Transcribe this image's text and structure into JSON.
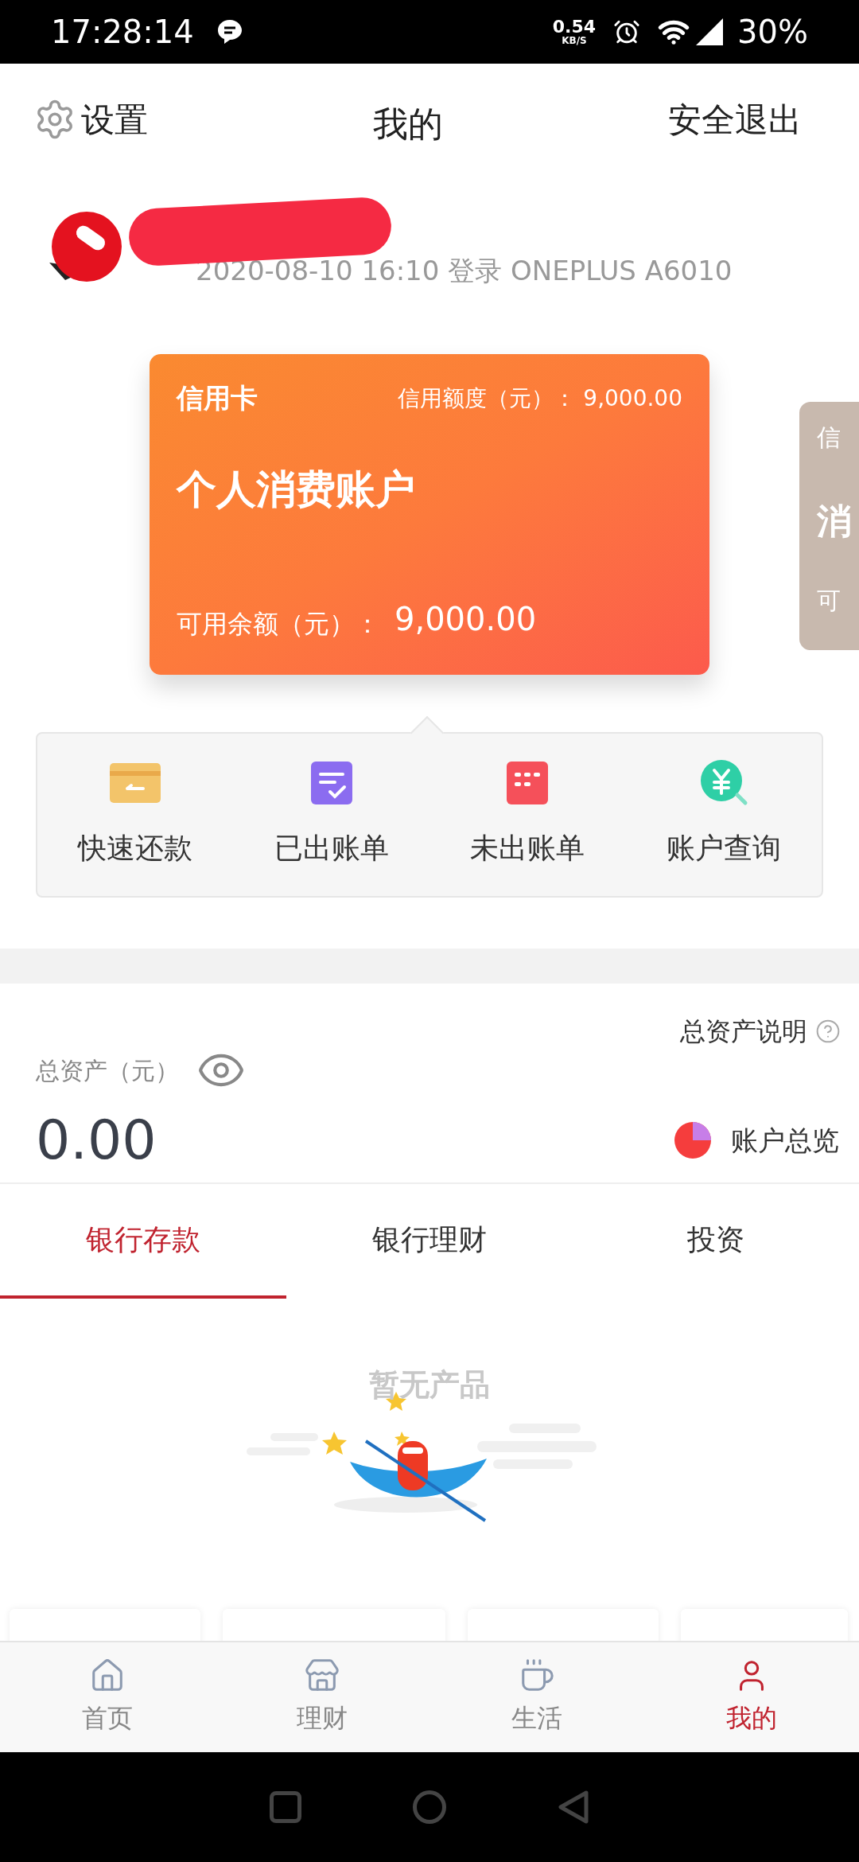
{
  "status_bar": {
    "time": "17:28:14",
    "speed": "0.54",
    "speed_unit": "KB/S",
    "battery": "30%"
  },
  "header": {
    "settings": "设置",
    "title": "我的",
    "logout": "安全退出"
  },
  "profile": {
    "last_login": "2020-08-10 16:10 登录 ONEPLUS A6010"
  },
  "card": {
    "type": "信用卡",
    "limit_label": "信用额度（元）：",
    "limit": "9,000.00",
    "name": "个人消费账户",
    "balance_label": "可用余额（元）：",
    "balance": "9,000.00"
  },
  "peek_card": {
    "type": "信",
    "name": "消",
    "balance_label": "可"
  },
  "actions": [
    {
      "kind": "repay",
      "label": "快速还款"
    },
    {
      "kind": "billed",
      "label": "已出账单"
    },
    {
      "kind": "unbilled",
      "label": "未出账单"
    },
    {
      "kind": "query",
      "label": "账户查询"
    }
  ],
  "assets": {
    "label": "总资产（元）",
    "amount": "0.00",
    "help": "总资产说明",
    "overview": "账户总览"
  },
  "tabs": [
    {
      "label": "银行存款",
      "selected": true
    },
    {
      "label": "银行理财",
      "selected": false
    },
    {
      "label": "投资",
      "selected": false
    }
  ],
  "empty": {
    "message": "暂无产品"
  },
  "bottom_nav": [
    {
      "kind": "home",
      "label": "首页",
      "selected": false
    },
    {
      "kind": "finance",
      "label": "理财",
      "selected": false
    },
    {
      "kind": "life",
      "label": "生活",
      "selected": false
    },
    {
      "kind": "me",
      "label": "我的",
      "selected": true
    }
  ]
}
